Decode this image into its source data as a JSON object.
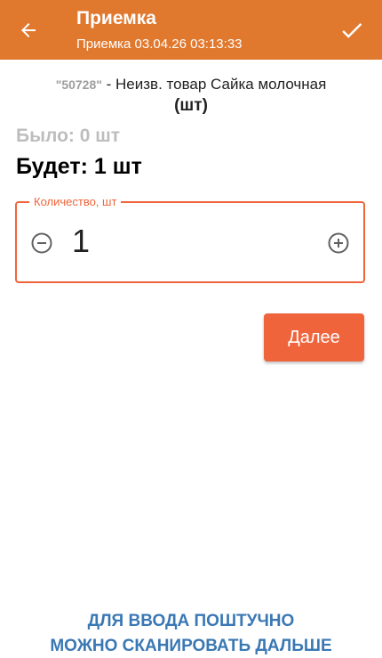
{
  "header": {
    "title": "Приемка",
    "subtitle": "Приемка 03.04.26 03:13:33",
    "background_color": "#E0782E",
    "back_icon": "arrow-left-icon",
    "confirm_icon": "check-icon"
  },
  "product": {
    "code": "\"50728\"",
    "separator": " - ",
    "name": "Неизв. товар Сайка молочная",
    "unit": "(шт)"
  },
  "quantities": {
    "was": "Было: 0 шт",
    "will": "Будет: 1 шт"
  },
  "quantity_field": {
    "label": "Количество, шт",
    "value": "1",
    "accent_color": "#F0643C",
    "minus_icon": "minus-circle-icon",
    "plus_icon": "plus-circle-icon"
  },
  "actions": {
    "next_label": "Далее"
  },
  "hint": {
    "line1": "ДЛЯ ВВОДА ПОШТУЧНО",
    "line2": "МОЖНО СКАНИРОВАТЬ ДАЛЬШЕ",
    "color": "#3A78B4"
  }
}
